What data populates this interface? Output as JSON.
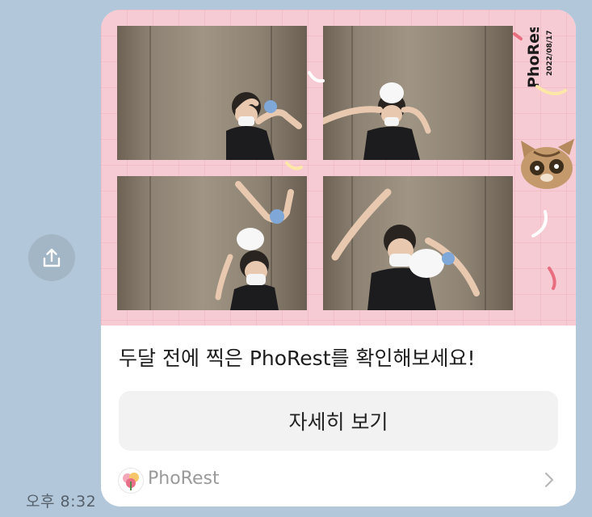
{
  "chat": {
    "time": "오후 8:32"
  },
  "card": {
    "brand_text": "PhoRest",
    "date_text": "2022/08/17",
    "message": "두달 전에 찍은 PhoRest를 확인해보세요!",
    "detail_button": "자세히 보기",
    "channel_name": "PhoRest"
  },
  "colors": {
    "chat_background": "#b2c7d9",
    "frame_pink": "#f6cbd3",
    "card_background": "#ffffff",
    "button_background": "#f2f2f2"
  },
  "icons": {
    "share": "share-upload-icon",
    "chevron": "chevron-right-icon",
    "channel_logo": "phorest-logo-icon"
  }
}
